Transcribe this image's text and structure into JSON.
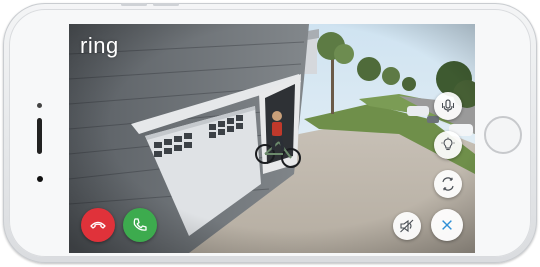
{
  "app": {
    "logo_text": "ring"
  },
  "controls": {
    "mic": {
      "icon": "microphone-icon"
    },
    "light": {
      "icon": "light-icon"
    },
    "camera_switch": {
      "icon": "camera-switch-icon"
    },
    "speaker": {
      "icon": "speaker-mute-icon"
    },
    "close": {
      "icon": "close-icon"
    },
    "decline": {
      "icon": "phone-hangup-icon"
    },
    "answer": {
      "icon": "phone-icon"
    }
  },
  "colors": {
    "decline": "#e0323a",
    "answer": "#3dab4e",
    "close_icon": "#2f8fd6",
    "control_icon": "#4a4f55"
  }
}
